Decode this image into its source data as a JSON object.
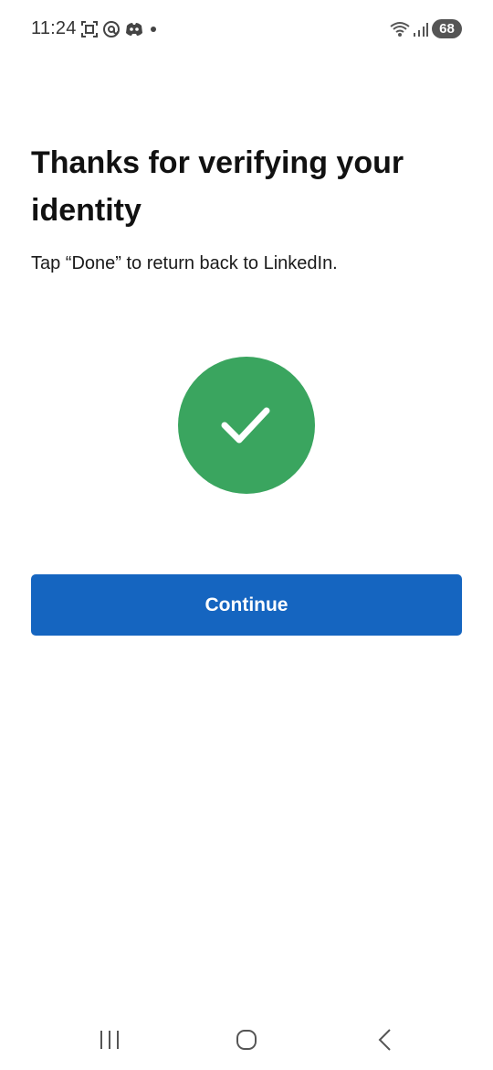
{
  "status_bar": {
    "time": "11:24",
    "battery_level": "68",
    "icons": [
      "screenshot-icon",
      "threads-icon",
      "discord-icon",
      "notification-dot-icon",
      "wifi-icon",
      "signal-icon",
      "battery-icon"
    ]
  },
  "content": {
    "title": "Thanks for verifying your identity",
    "subtitle": "Tap “Done” to return back to LinkedIn.",
    "success_icon": "checkmark-icon",
    "success_color": "#3aa55f"
  },
  "actions": {
    "continue_label": "Continue",
    "button_color": "#1565c0"
  },
  "nav_bar": {
    "icons": [
      "recent-apps-icon",
      "home-icon",
      "back-icon"
    ]
  }
}
